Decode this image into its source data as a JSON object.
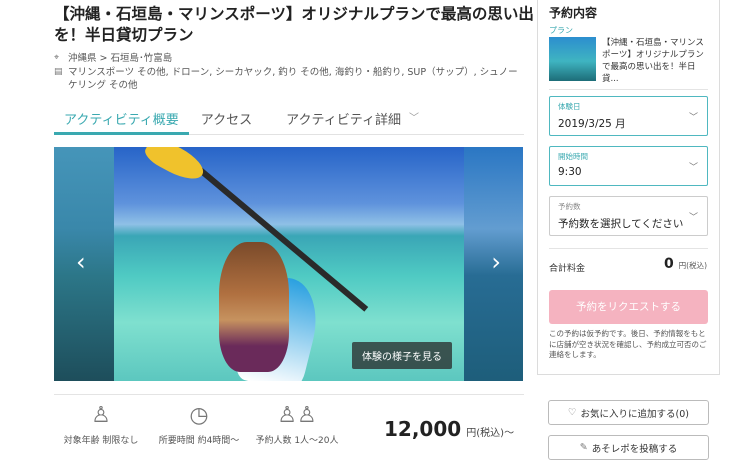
{
  "header": {
    "title": "【沖縄・石垣島・マリンスポーツ】オリジナルプランで最高の思い出を！半日貸切プラン",
    "location": "沖縄県 > 石垣島･竹富島",
    "categories": "マリンスポーツ その他, ドローン, シーカヤック, 釣り その他, 海釣り・船釣り, SUP（サップ）, シュノーケリング その他"
  },
  "tabs": [
    {
      "label": "アクティビティ概要",
      "active": true
    },
    {
      "label": "アクセス",
      "active": false
    },
    {
      "label": "アクティビティ詳細",
      "active": false
    }
  ],
  "gallery": {
    "view_button": "体験の様子を見る"
  },
  "info": {
    "age": "対象年齢 制限なし",
    "duration": "所要時間 約4時間〜",
    "people": "予約人数 1人〜20人",
    "price_amount": "12,000",
    "price_suffix": "円(税込)〜"
  },
  "booking": {
    "title": "予約内容",
    "plan_label": "プラン",
    "plan_text": "【沖縄・石垣島・マリンスポーツ】オリジナルプランで最高の思い出を！半日貸...",
    "date_label": "体験日",
    "date_value": "2019/3/25 月",
    "time_label": "開始時間",
    "time_value": "9:30",
    "count_label": "予約数",
    "count_value": "予約数を選択してください",
    "total_label": "合計料金",
    "total_amount": "0",
    "total_unit": "円(税込)",
    "request_button": "予約をリクエストする",
    "note": "この予約は仮予約です。後日、予約情報をもとに店舗が空き状況を確認し、予約成立可否のご連絡をします。"
  },
  "actions": {
    "favorite": "お気に入りに追加する(0)",
    "post_report": "あそレポを投稿する"
  },
  "colors": {
    "accent": "#3aa9b0",
    "request_button": "#f5b3c0"
  }
}
